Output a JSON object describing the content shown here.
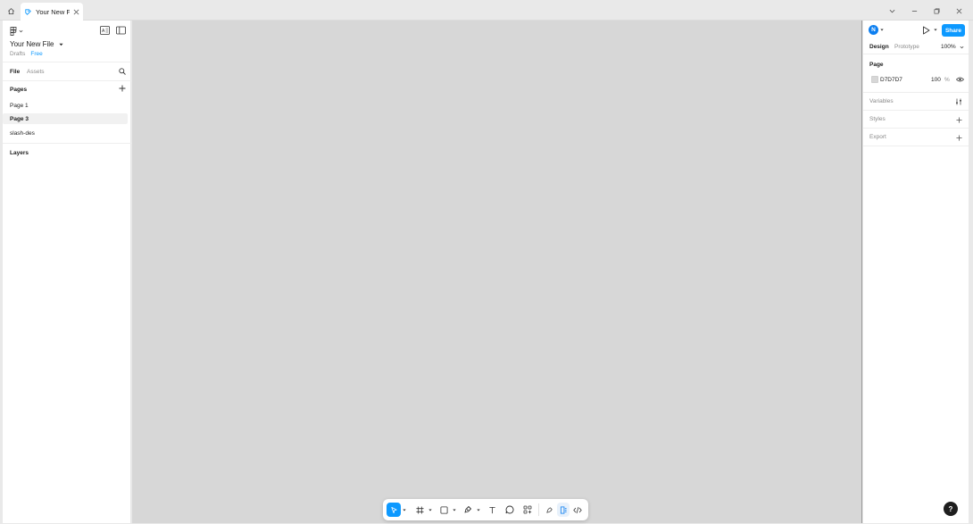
{
  "window": {
    "tab_title": "Your New File"
  },
  "left_panel": {
    "file_title": "Your New File",
    "location": "Drafts",
    "plan_badge": "Free",
    "tabs": [
      {
        "label": "File",
        "active": true
      },
      {
        "label": "Assets",
        "active": false
      }
    ],
    "pages_heading": "Pages",
    "pages": [
      {
        "label": "Page 1",
        "active": false
      },
      {
        "label": "Page 3",
        "active": true
      },
      {
        "label": "slash-des",
        "active": false
      }
    ],
    "layers_heading": "Layers"
  },
  "right_panel": {
    "avatar_initial": "N",
    "share_label": "Share",
    "tabs": [
      {
        "label": "Design",
        "active": true
      },
      {
        "label": "Prototype",
        "active": false
      }
    ],
    "zoom": "100%",
    "page_heading": "Page",
    "page_color": "D7D7D7",
    "page_opacity": "100",
    "percent_sign": "%",
    "variables_label": "Variables",
    "styles_label": "Styles",
    "export_label": "Export"
  },
  "help_label": "?",
  "colors": {
    "accent": "#0d99ff",
    "canvas": "#d7d7d7",
    "panel": "#ffffff"
  },
  "icons": {
    "home": "home-icon",
    "figma_file": "file-icon",
    "close": "close-icon",
    "main_menu": "figma-logo-icon",
    "toolbar": [
      "move-icon",
      "frame-icon",
      "rectangle-icon",
      "pen-icon",
      "text-icon",
      "comment-icon",
      "actions-icon",
      "draw-icon",
      "design-mode-icon",
      "dev-mode-icon"
    ]
  }
}
